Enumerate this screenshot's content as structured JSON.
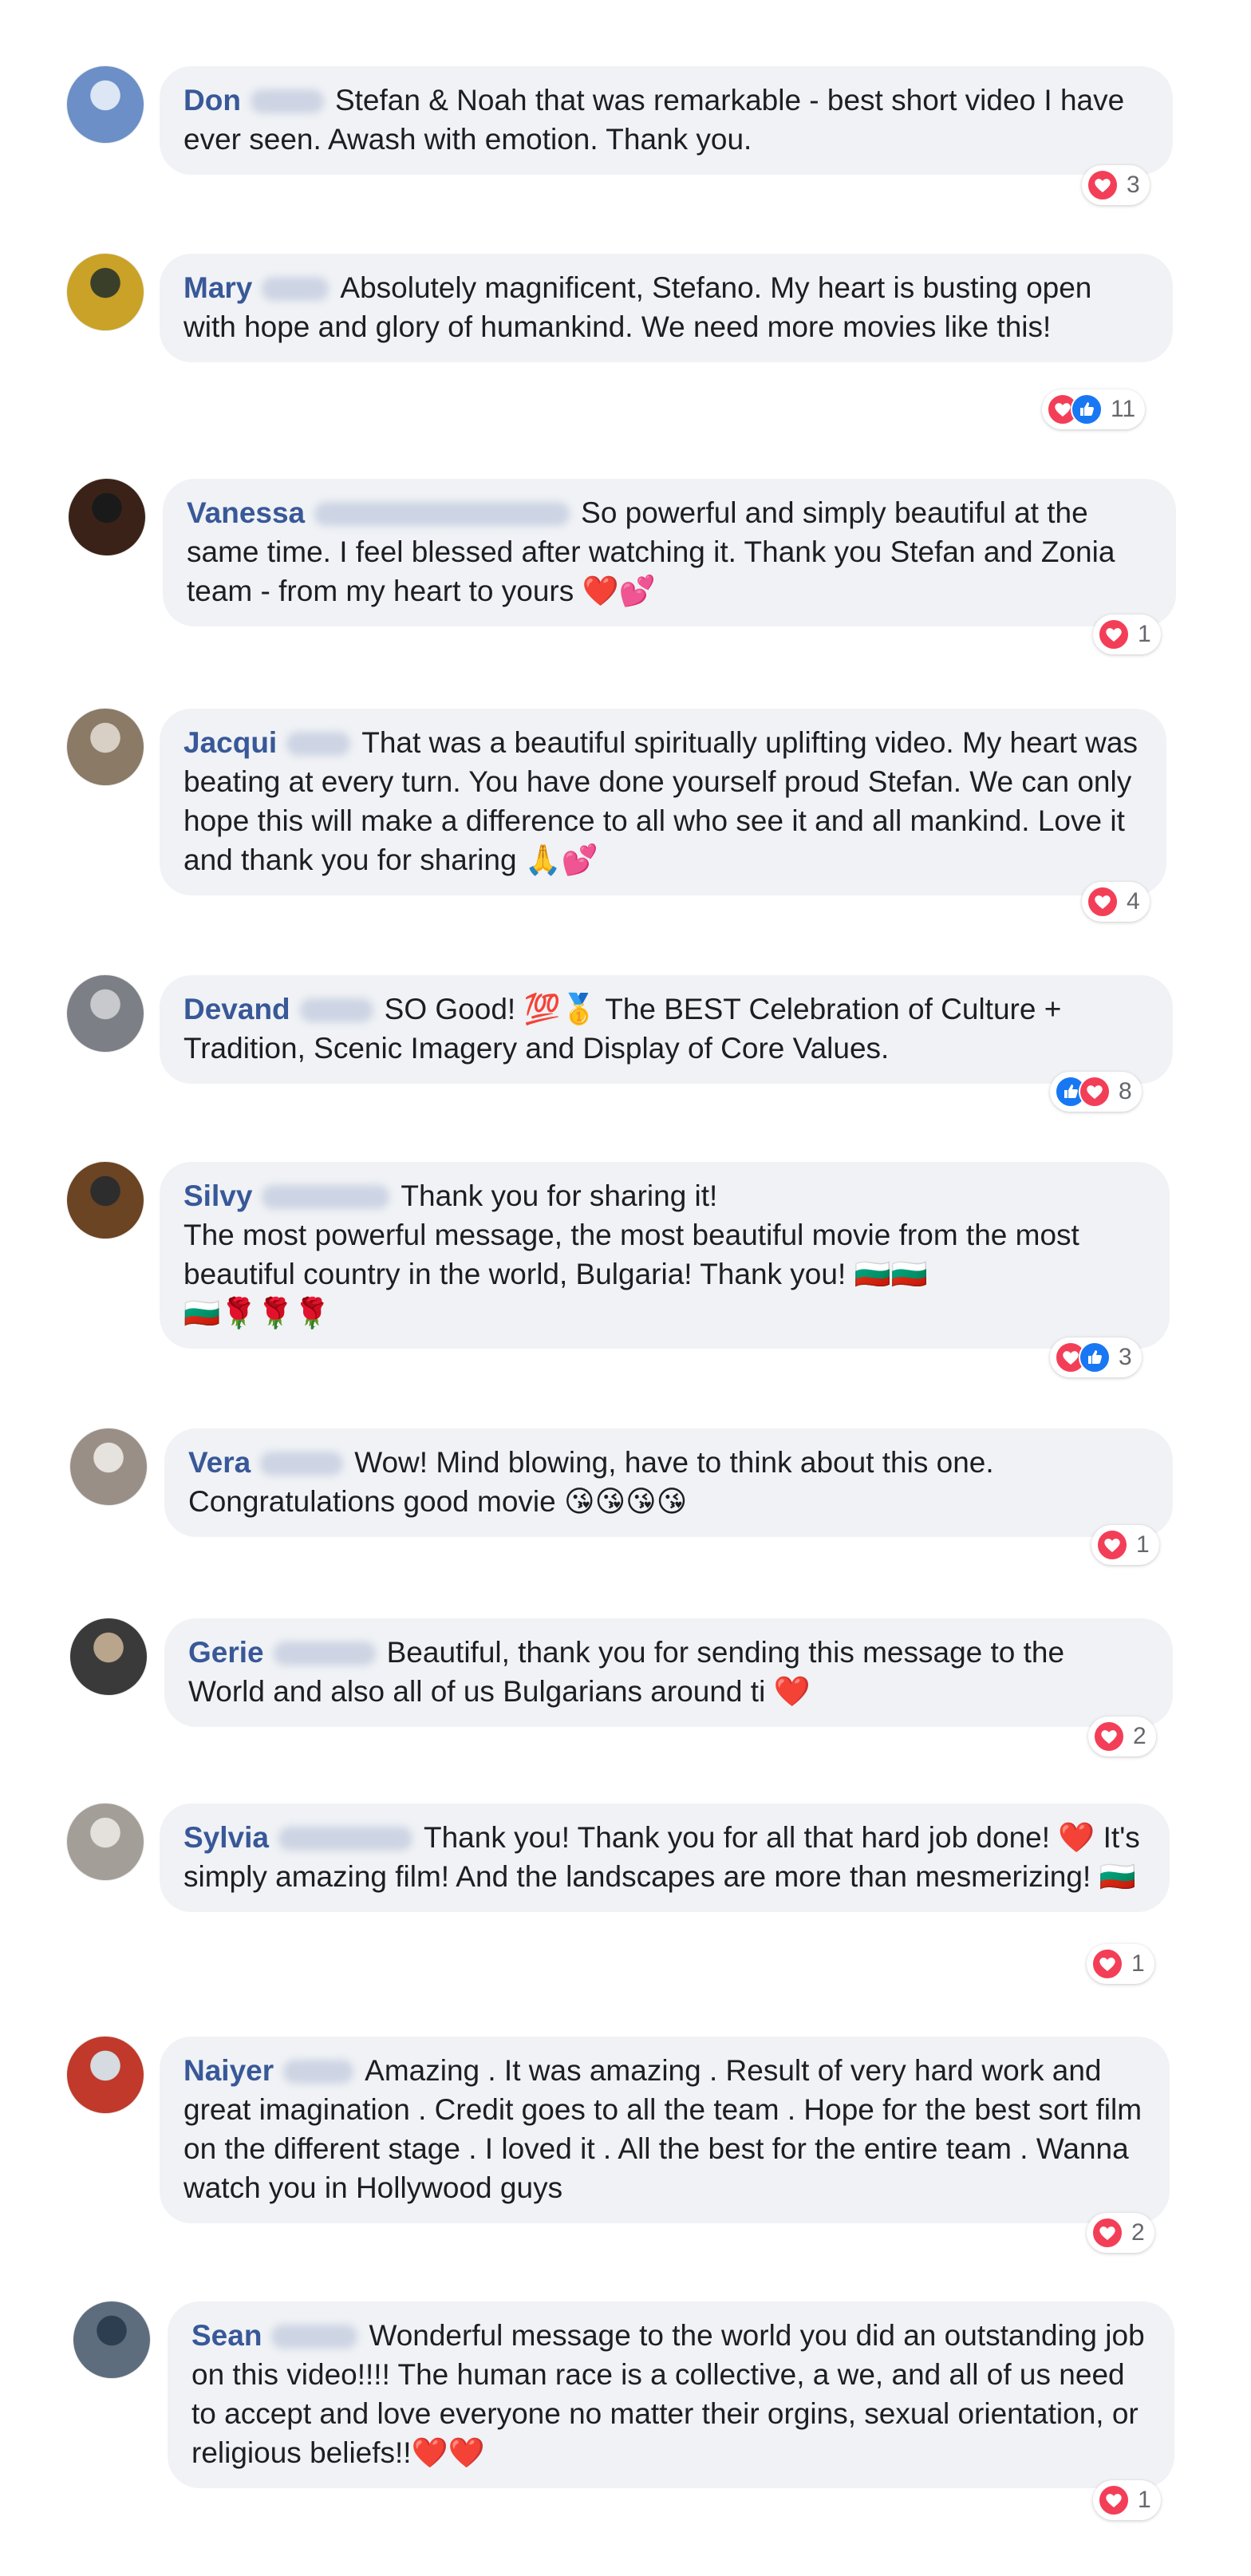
{
  "comments": [
    {
      "first": "Don",
      "text": "Stefan & Noah that was remarkable - best short video I have ever seen. Awash with emotion. Thank you.",
      "count": "3",
      "reactions": [
        "love"
      ],
      "colors": [
        "#6b8fc6",
        "#dce6f5"
      ]
    },
    {
      "first": "Mary",
      "text": "Absolutely magnificent, Stefano. My heart is busting open with hope and glory of humankind. We need more movies like this!",
      "count": "11",
      "reactions": [
        "love",
        "like"
      ],
      "colors": [
        "#c9a227",
        "#3a3f2a"
      ]
    },
    {
      "first": "Vanessa",
      "text": "So powerful and simply beautiful at the same time. I feel blessed after watching it. Thank you Stefan and Zonia team - from my heart to yours ❤️💕",
      "count": "1",
      "reactions": [
        "love"
      ],
      "colors": [
        "#3b2218",
        "#1a1a1a"
      ]
    },
    {
      "first": "Jacqui",
      "text": "That was a beautiful spiritually uplifting video. My heart was beating at every turn. You have done yourself proud Stefan. We can only hope this will make a difference to all who see it and all mankind. Love it and thank you for sharing 🙏💕",
      "count": "4",
      "reactions": [
        "love"
      ],
      "colors": [
        "#8a7a66",
        "#d8d0c4"
      ]
    },
    {
      "first": "Devand",
      "text": "SO Good! 💯🥇 The BEST Celebration of Culture + Tradition, Scenic Imagery and Display of Core Values.",
      "count": "8",
      "reactions": [
        "like",
        "love"
      ],
      "colors": [
        "#7d7f86",
        "#c8c9cc"
      ]
    },
    {
      "first": "Silvy",
      "text": "Thank you for sharing it!\nThe most powerful message, the most beautiful movie from the most beautiful country in the world, Bulgaria! Thank you! 🇧🇬🇧🇬\n🇧🇬🌹🌹🌹",
      "count": "3",
      "reactions": [
        "love",
        "like"
      ],
      "colors": [
        "#6b4423",
        "#2d2d2d"
      ]
    },
    {
      "first": "Vera",
      "text": "Wow! Mind blowing, have to think about this one. Congratulations good movie 😘😘😘😘",
      "count": "1",
      "reactions": [
        "love"
      ],
      "colors": [
        "#9a8f86",
        "#e6e2de"
      ]
    },
    {
      "first": "Gerie",
      "text": "Beautiful, thank you for sending this message to the World and also all of us Bulgarians around ti ❤️",
      "count": "2",
      "reactions": [
        "love"
      ],
      "colors": [
        "#3a3a3a",
        "#b9a58c"
      ]
    },
    {
      "first": "Sylvia",
      "text": "Thank you! Thank you for all that hard job done! ❤️ It's simply amazing film! And the landscapes are more than mesmerizing! 🇧🇬",
      "count": "1",
      "reactions": [
        "love"
      ],
      "colors": [
        "#a39f98",
        "#e4e1dc"
      ]
    },
    {
      "first": "Naiyer",
      "text": "Amazing . It was amazing . Result of very hard work and great imagination . Credit goes to all the team . Hope for the best sort film on the different stage . I loved it . All the best for the entire team . Wanna watch you in Hollywood guys",
      "count": "2",
      "reactions": [
        "love"
      ],
      "colors": [
        "#c0392b",
        "#d5dbe0"
      ]
    },
    {
      "first": "Sean",
      "text": "Wonderful message to the world you did an outstanding job on this video!!!! The human race is a collective, a we, and all of us need to accept and love everyone no matter their orgins, sexual orientation, or religious beliefs!!❤️❤️",
      "count": "1",
      "reactions": [
        "love"
      ],
      "colors": [
        "#5d6d7e",
        "#2c3e50"
      ]
    }
  ]
}
